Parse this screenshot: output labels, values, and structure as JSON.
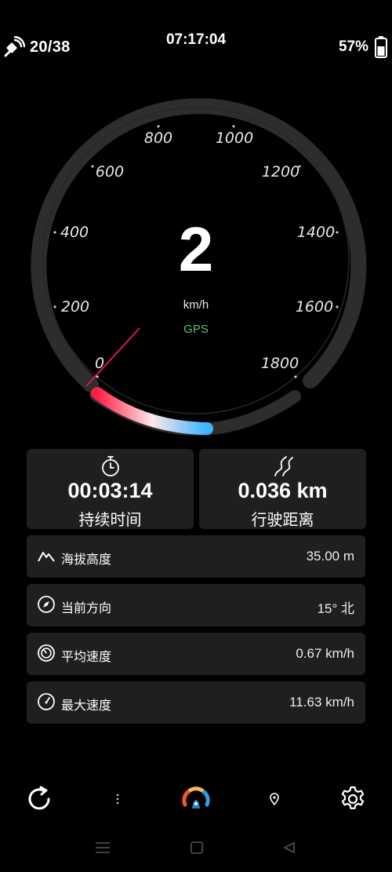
{
  "status": {
    "satellites": "20/38",
    "time": "07:17:04",
    "battery": "57%"
  },
  "gauge": {
    "speed": "2",
    "unit": "km/h",
    "source": "GPS",
    "ticks": [
      "0",
      "200",
      "400",
      "600",
      "800",
      "1000",
      "1200",
      "1400",
      "1600",
      "1800"
    ],
    "min": 0,
    "max": 1800,
    "needle_value": 0,
    "colors": {
      "arc_start": "#ff1e46",
      "arc_end": "#3ab5ff",
      "source": "#59c07a"
    }
  },
  "stats": {
    "duration": {
      "value": "00:03:14",
      "label": "持续时间",
      "icon": "stopwatch-icon"
    },
    "distance": {
      "value": "0.036 km",
      "label": "行驶距离",
      "icon": "road-icon"
    }
  },
  "metrics": [
    {
      "label": "海拔高度",
      "value": "35.00 m",
      "icon": "mountain-icon"
    },
    {
      "label": "当前方向",
      "value": "15° 北",
      "icon": "compass-icon"
    },
    {
      "label": "平均速度",
      "value": "0.67 km/h",
      "icon": "average-speed-icon"
    },
    {
      "label": "最大速度",
      "value": "11.63 km/h",
      "icon": "max-speed-icon"
    }
  ]
}
